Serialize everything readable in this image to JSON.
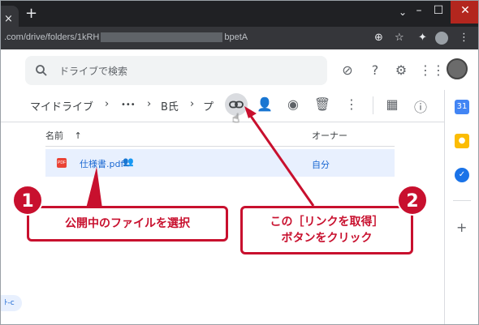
{
  "browser": {
    "url_prefix": ".com/drive/folders/1kRH",
    "url_suffix": "bpetA",
    "new_tab": "+",
    "tab_close": "×",
    "minimize": "–",
    "maximize": "☐",
    "close": "✕"
  },
  "drive": {
    "search_placeholder": "ドライブで検索"
  },
  "toolbar": {
    "breadcrumb_root": "マイドライブ",
    "breadcrumb_sep": "›",
    "breadcrumb_more": "•••",
    "breadcrumb_item1": "B氏",
    "breadcrumb_item2": "プ"
  },
  "file_list": {
    "col_name": "名前",
    "sort_arrow": "↑",
    "col_owner": "オーナー",
    "rows": [
      {
        "name": "仕様書.pdf",
        "owner": "自分",
        "icon_label": "PDF"
      }
    ]
  },
  "bottom_chip": "ﾄ-c",
  "annotations": {
    "badge1": "1",
    "badge2": "2",
    "callout1": "公開中のファイルを選択",
    "callout2_line1": "この［リンクを取得］",
    "callout2_line2": "ボタンをクリック"
  },
  "colors": {
    "annotation_red": "#c8102e",
    "selection_bg": "#e8f0fe",
    "link_blue": "#1967d2"
  }
}
